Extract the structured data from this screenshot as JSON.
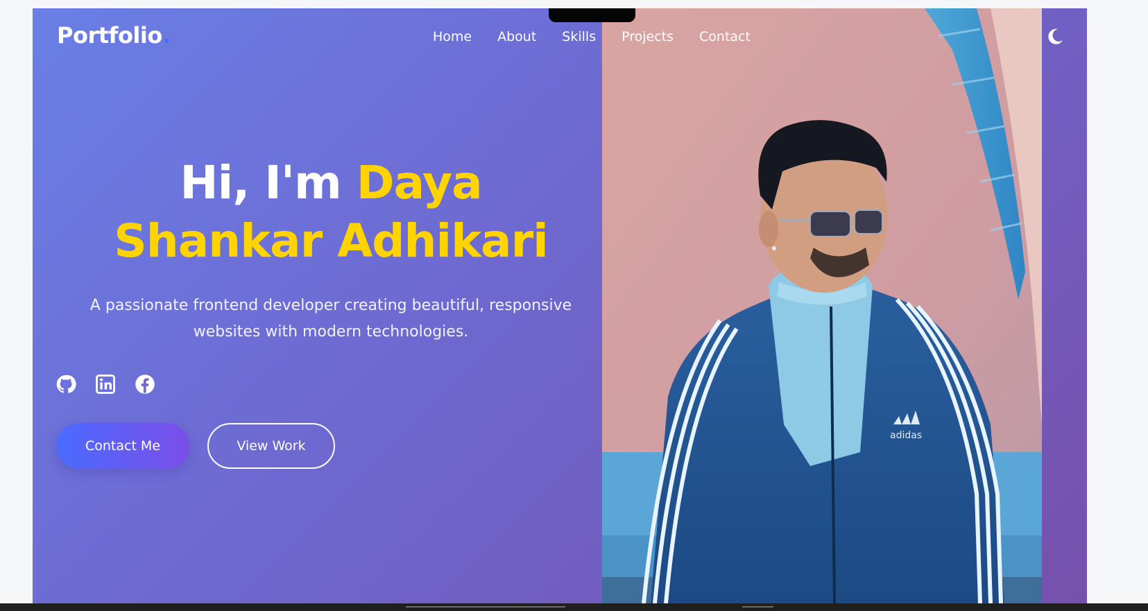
{
  "header": {
    "logo_text": "Portfolio",
    "logo_dot": ".",
    "nav": [
      {
        "label": "Home"
      },
      {
        "label": "About"
      },
      {
        "label": "Skills"
      },
      {
        "label": "Projects"
      },
      {
        "label": "Contact"
      }
    ],
    "theme_toggle_icon": "moon-icon"
  },
  "hero": {
    "greeting": "Hi, I'm ",
    "name_part1": "Daya",
    "name_part2": "Shankar Adhikari",
    "subtitle": "A passionate frontend developer creating beautiful, responsive websites with modern technologies.",
    "social_icons": [
      "github-icon",
      "linkedin-icon",
      "facebook-icon"
    ],
    "contact_button": "Contact Me",
    "work_button": "View Work",
    "photo_logo": "adidas"
  },
  "colors": {
    "highlight": "#ffd400",
    "gradient_start": "#6a7fe6",
    "gradient_end": "#7750ad",
    "button_start": "#4b6bff",
    "button_end": "#7a4ee8"
  }
}
